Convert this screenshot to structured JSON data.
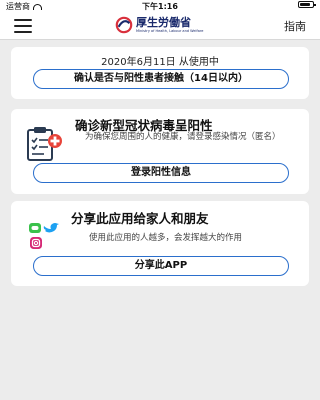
{
  "status_bar": {
    "carrier": "运营商",
    "time": "下午1:16"
  },
  "header": {
    "logo_title": "厚生労働省",
    "logo_subtitle": "Ministry of Health, Labour and Welfare",
    "guide_label": "指南"
  },
  "card_contact": {
    "date_text": "2020年6月11日 从使用中",
    "button_label": "确认是否与阳性患者接触（14日以内）"
  },
  "card_positive": {
    "title": "确诊新型冠状病毒呈阳性",
    "description": "为确保您周围的人的健康，请登录感染情况（匿名）",
    "button_label": "登录阳性信息"
  },
  "card_share": {
    "title": "分享此应用给家人和朋友",
    "description": "使用此应用的人越多，会发挥越大的作用",
    "button_label": "分享此APP"
  },
  "colors": {
    "accent_blue": "#2b6fcc",
    "background": "#ececec",
    "card": "#ffffff",
    "logo_red": "#d9303c",
    "logo_blue": "#1a2a6c"
  }
}
